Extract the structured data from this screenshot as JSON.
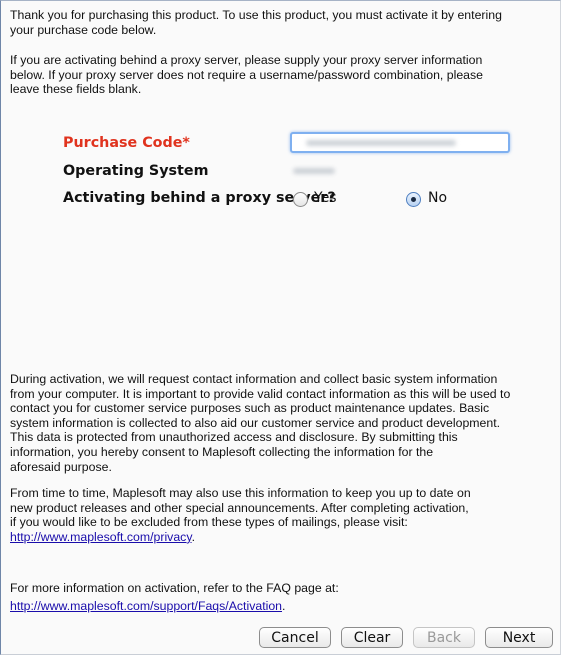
{
  "intro": {
    "p1_line1": "Thank you for purchasing this product. To use this product, you must activate it by entering",
    "p1_line2": "your purchase code below.",
    "p2_line1": "If you are activating behind a proxy server, please supply your proxy server information",
    "p2_line2": "below. If your proxy server does not require a username/password combination, please",
    "p2_line3": "leave these fields blank."
  },
  "form": {
    "purchase_code_label": "Purchase Code*",
    "operating_system_label": "Operating System",
    "proxy_label": "Activating behind a proxy server?",
    "proxy_yes": "Yes",
    "proxy_no": "No",
    "proxy_selected": "No"
  },
  "notice": {
    "lines": [
      "During activation, we will request contact information and collect basic system information",
      "from your computer. It is important to provide valid contact information as this will be used to",
      "contact you for customer service purposes such as product maintenance updates. Basic",
      "system information is collected to also aid our customer service and product development.",
      "This data is protected from unauthorized access and disclosure. By submitting this",
      "information, you hereby consent to Maplesoft collecting the information for the",
      "aforesaid purpose."
    ],
    "mail_lines": [
      "From time to time, Maplesoft may also use this information to keep you up to date on",
      "new product releases and other special announcements. After completing activation,",
      "if you would like to be excluded from these types of mailings, please visit:"
    ],
    "privacy_link": "http://www.maplesoft.com/privacy",
    "privacy_link_suffix": ".",
    "faq_line": "For more information on activation, refer to the FAQ page at:",
    "faq_link": "http://www.maplesoft.com/support/Faqs/Activation",
    "faq_link_suffix": "."
  },
  "buttons": {
    "cancel": "Cancel",
    "clear": "Clear",
    "back": "Back",
    "next": "Next"
  }
}
